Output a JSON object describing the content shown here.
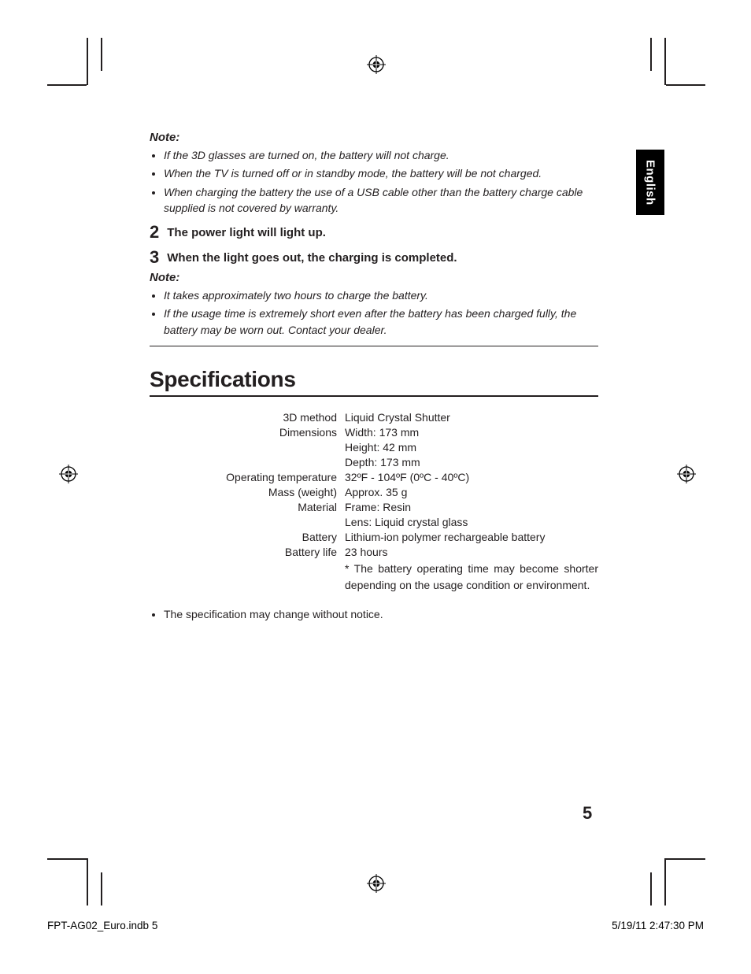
{
  "language_tab": "English",
  "note1": {
    "heading": "Note:",
    "items": [
      "If the 3D glasses are turned on, the battery will not charge.",
      "When the TV is turned off or in standby mode, the battery will be not charged.",
      "When charging the battery the use of a USB cable other than the battery charge cable supplied is not covered by warranty."
    ]
  },
  "steps": [
    {
      "num": "2",
      "text": "The power light will light up."
    },
    {
      "num": "3",
      "text": "When the light goes out, the charging is completed."
    }
  ],
  "note2": {
    "heading": "Note:",
    "items": [
      "It takes approximately two hours to charge the battery.",
      "If the usage time is extremely short even after the battery has been charged fully, the battery may be worn out. Contact your dealer."
    ]
  },
  "spec_heading": "Specifications",
  "specs": {
    "method_label": "3D method",
    "method_value": "Liquid Crystal Shutter",
    "dimensions_label": "Dimensions",
    "dimensions_width": "Width: 173 mm",
    "dimensions_height": "Height: 42 mm",
    "dimensions_depth": "Depth: 173 mm",
    "temp_label": "Operating temperature",
    "temp_value": "32ºF - 104ºF (0ºC - 40ºC)",
    "mass_label": "Mass (weight)",
    "mass_value": "Approx. 35 g",
    "material_label": "Material",
    "material_frame": "Frame: Resin",
    "material_lens": "Lens: Liquid crystal glass",
    "battery_label": "Battery",
    "battery_value": "Lithium-ion polymer rechargeable battery",
    "life_label": "Battery life",
    "life_value": "23 hours",
    "life_note": "*  The battery operating time may become shorter depending on the usage condition or environment."
  },
  "tail_note": "The specification may change without notice.",
  "page_number": "5",
  "footer": {
    "file": "FPT-AG02_Euro.indb   5",
    "datetime": "5/19/11   2:47:30 PM"
  }
}
